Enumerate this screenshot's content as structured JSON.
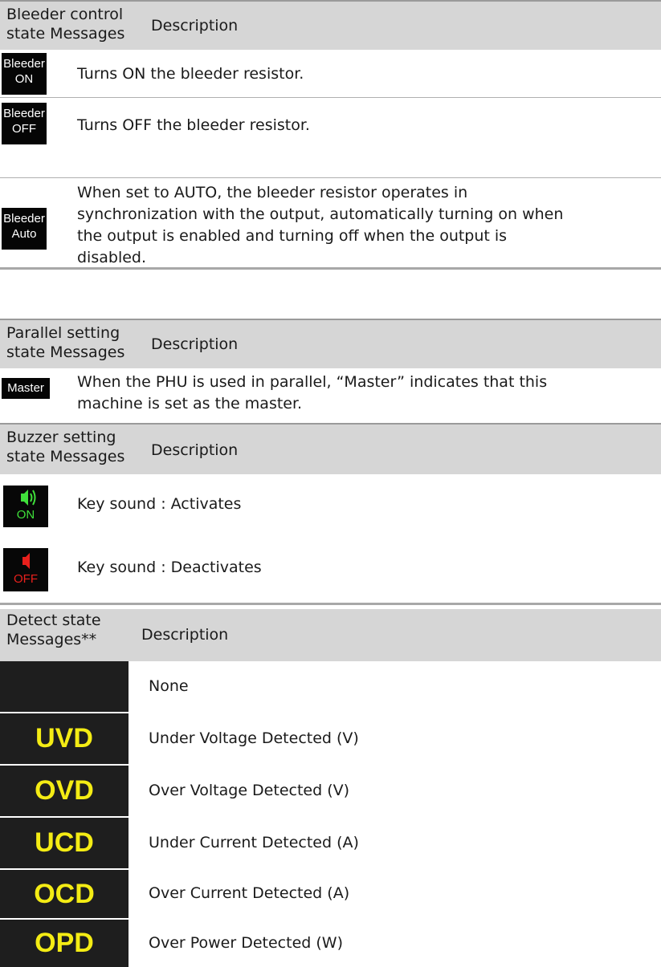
{
  "bleeder": {
    "header": {
      "col1_line1": "Bleeder control",
      "col1_line2": "state  Messages",
      "col2": "Description"
    },
    "rows": [
      {
        "icon_line1": "Bleeder",
        "icon_line2": "ON",
        "desc": "Turns ON the bleeder resistor."
      },
      {
        "icon_line1": "Bleeder",
        "icon_line2": "OFF",
        "desc": "Turns OFF the bleeder resistor."
      },
      {
        "icon_line1": "Bleeder",
        "icon_line2": "Auto",
        "desc_lines": [
          "When set to AUTO, the bleeder resistor operates in",
          "synchronization with the output, automatically turning on when",
          "the output is enabled and turning off when the output is",
          "disabled."
        ]
      }
    ]
  },
  "parallel": {
    "header": {
      "col1_line1": "Parallel setting",
      "col1_line2": "state  Messages",
      "col2": "Description"
    },
    "rows": [
      {
        "icon": "Master",
        "desc_lines": [
          "When the PHU is used in parallel, “Master” indicates that this",
          "machine is set as the master."
        ]
      }
    ]
  },
  "buzzer": {
    "header": {
      "col1_line1": "Buzzer setting",
      "col1_line2": "state  Messages",
      "col2": "Description"
    },
    "rows": [
      {
        "icon_name": "speaker-on-icon",
        "icon_label": "ON",
        "color": "#3fe03a",
        "desc": "Key sound : Activates"
      },
      {
        "icon_name": "speaker-off-icon",
        "icon_label": "OFF",
        "color": "#e8201c",
        "desc": "Key sound : Deactivates"
      }
    ]
  },
  "detect": {
    "header": {
      "col1_line1": "Detect  state",
      "col1_line2": "Messages**",
      "col2": "Description"
    },
    "rows": [
      {
        "code": "",
        "desc": "None"
      },
      {
        "code": "UVD",
        "desc": "Under Voltage Detected (V)"
      },
      {
        "code": "OVD",
        "desc": "Over Voltage Detected (V)"
      },
      {
        "code": "UCD",
        "desc": "Under Current Detected (A)"
      },
      {
        "code": "OCD",
        "desc": "Over Current Detected (A)"
      },
      {
        "code": "OPD",
        "desc": "Over Power Detected (W)"
      }
    ],
    "code_color": "#f4ec14"
  }
}
